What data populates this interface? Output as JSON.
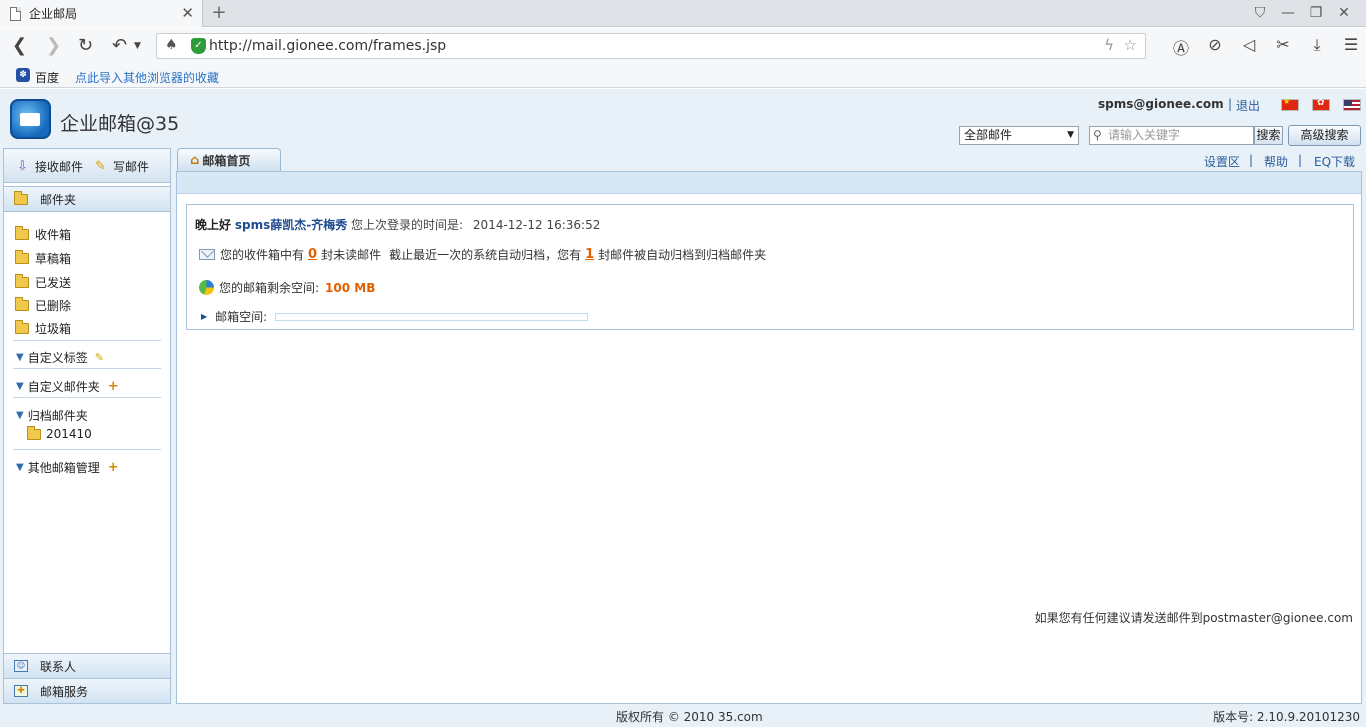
{
  "browser": {
    "tab_title": "企业邮局",
    "url": "http://mail.gionee.com/frames.jsp",
    "bookmarks": {
      "baidu": "百度",
      "import": "点此导入其他浏览器的收藏"
    }
  },
  "header": {
    "app_title": "企业邮箱@35",
    "user_email": "spms@gionee.com",
    "logout": "退出",
    "search": {
      "scope": "全部邮件",
      "placeholder": "请输入关键字",
      "search_label": "搜索",
      "advanced_label": "高级搜索"
    }
  },
  "sidebar": {
    "receive": "接收邮件",
    "compose": "写邮件",
    "folders_head": "邮件夹",
    "folders": [
      "收件箱",
      "草稿箱",
      "已发送",
      "已删除",
      "垃圾箱"
    ],
    "custom_tags": "自定义标签",
    "custom_folders": "自定义邮件夹",
    "archive_folders": "归档邮件夹",
    "archive_items": [
      "201410"
    ],
    "other_mail": "其他邮箱管理",
    "contacts": "联系人",
    "mail_services": "邮箱服务"
  },
  "main": {
    "tab": "邮箱首页",
    "links": {
      "settings": "设置区",
      "help": "帮助",
      "eq": "EQ下载",
      "sep": "|"
    },
    "greeting": "晚上好",
    "user_name": "spms薛凯杰-齐梅秀",
    "last_login_label": "您上次登录的时间是:",
    "last_login_time": "2014-12-12 16:36:52",
    "unread_pre": "您的收件箱中有",
    "unread_count": "0",
    "unread_post": "封未读邮件",
    "archive_pre": "截止最近一次的系统自动归档，您有",
    "archive_count": "1",
    "archive_post": "封邮件被自动归档到归档邮件夹",
    "space_label": "您的邮箱剩余空间:",
    "space_value": "100 MB",
    "quota_label": "邮箱空间:",
    "quota_used_fraction": 0.0,
    "suggestion": "如果您有任何建议请发送邮件到postmaster@gionee.com"
  },
  "footer": {
    "copyright": "版权所有 © 2010 35.com",
    "version": "版本号: 2.10.9.20101230"
  }
}
